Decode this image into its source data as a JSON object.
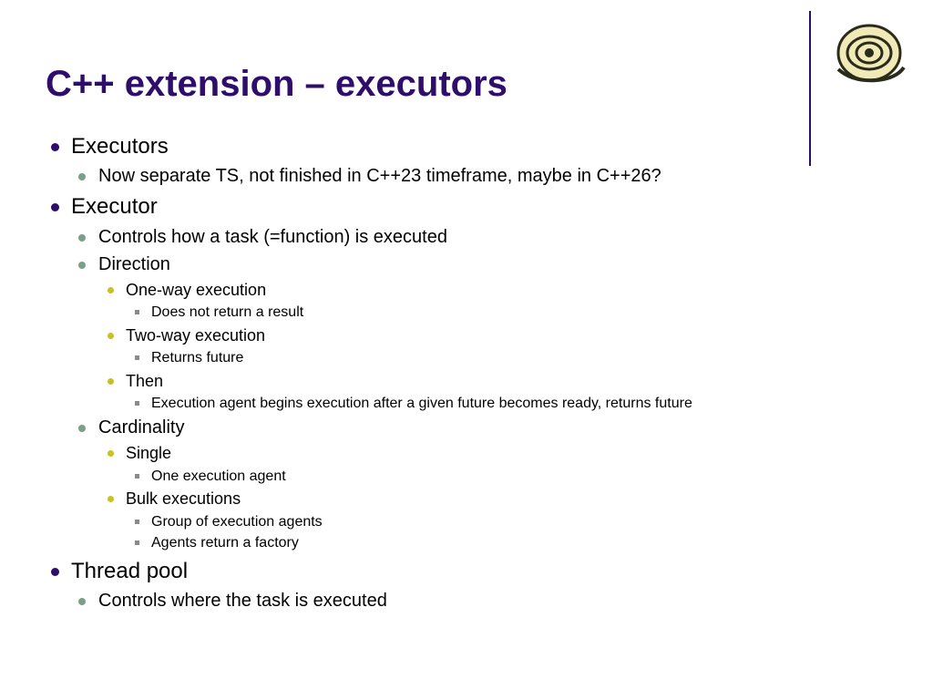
{
  "title": "C++ extension – executors",
  "s1": {
    "h": "Executors",
    "a": "Now separate TS, not finished in C++23 timeframe, maybe in C++26?"
  },
  "s2": {
    "h": "Executor",
    "a": "Controls how a task (=function) is executed",
    "dir": {
      "h": "Direction",
      "ow": {
        "h": "One-way execution",
        "a": "Does not return a result"
      },
      "tw": {
        "h": "Two-way execution",
        "a": "Returns future"
      },
      "th": {
        "h": "Then",
        "a": "Execution agent begins execution after a given future becomes ready, returns future"
      }
    },
    "card": {
      "h": "Cardinality",
      "sg": {
        "h": "Single",
        "a": "One execution agent"
      },
      "bk": {
        "h": "Bulk executions",
        "a": "Group of execution agents",
        "b": "Agents return a factory"
      }
    }
  },
  "s3": {
    "h": "Thread pool",
    "a": "Controls where the task is executed"
  }
}
